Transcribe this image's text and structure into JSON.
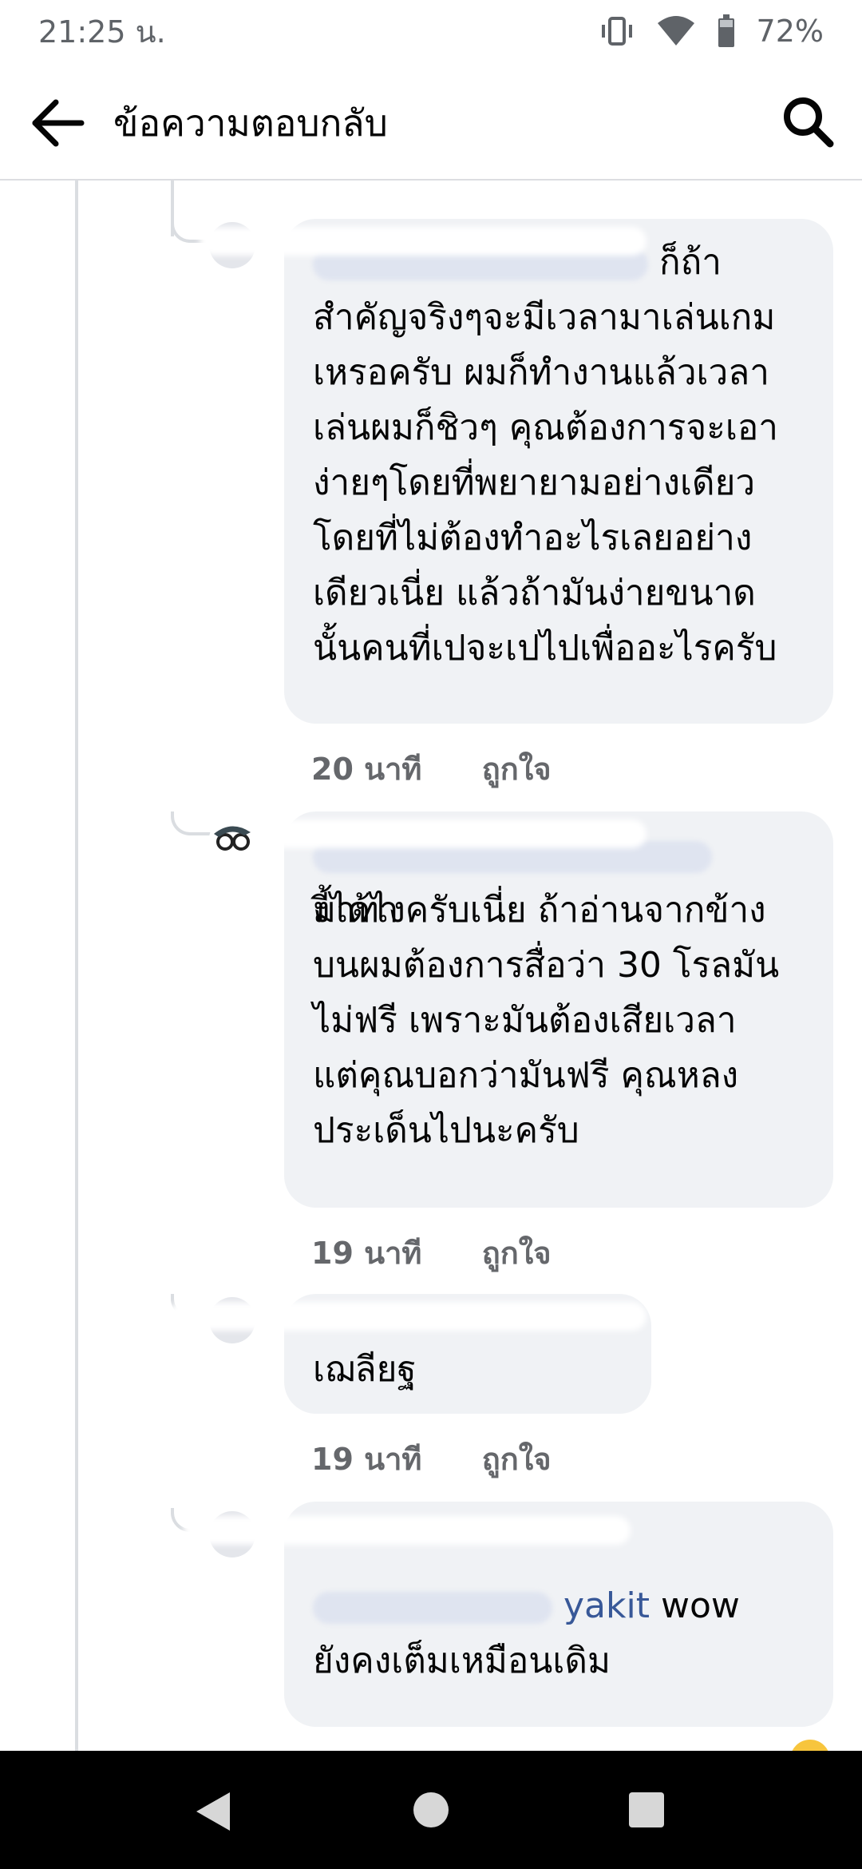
{
  "status_bar": {
    "time": "21:25 น.",
    "battery": "72%",
    "icons": [
      "vibrate-icon",
      "wifi-icon",
      "battery-icon"
    ]
  },
  "header": {
    "title": "ข้อความตอบกลับ",
    "back_icon": "arrow-left-icon",
    "search_icon": "search-icon"
  },
  "comments": [
    {
      "author": "",
      "mention_partial": "",
      "lines": [
        "ก็ถ้า",
        "สำคัญจริงๆจะมีเวลามาเล่นเกม",
        "เหรอครับ ผมก็ทำงานแล้วเวลา",
        "เล่นผมก็ชิวๆ คุณต้องการจะเอา",
        "ง่ายๆโดยที่พยายามอย่างเดียว",
        "โดยที่ไม่ต้องทำอะไรเลยอย่าง",
        "เดียวเนี่ย แล้วถ้ามันง่ายขนาด",
        "นั้นคนที่เปจะเปไปเพื่ออะไรครับ"
      ],
      "time": "20 นาที",
      "like_label": "ถูกใจ"
    },
    {
      "author": "",
      "lines": [
        "มาทา",
        "งี้ได้ไงครับเนี่ย ถ้าอ่านจากข้าง",
        "บนผมต้องการสื่อว่า 30 โรลมัน",
        "ไม่ฟรี เพราะมันต้องเสียเวลา",
        "แต่คุณบอกว่ามันฟรี คุณหลง",
        "ประเด็นไปนะครับ"
      ],
      "time": "19 นาที",
      "like_label": "ถูกใจ"
    },
    {
      "author": "",
      "lines": [
        "เฌลียฐ"
      ],
      "time": "19 นาที",
      "like_label": "ถูกใจ"
    },
    {
      "author": "",
      "mention_partial": "yakit",
      "lines": [
        "wow",
        "ยังคงเต็มเหมือนเดิม"
      ],
      "time": "",
      "like_label": ""
    }
  ],
  "nav": {
    "back": "triangle-back-icon",
    "home": "circle-home-icon",
    "recents": "square-recents-icon"
  },
  "colors": {
    "bubble": "#f0f2f5",
    "mention": "#385898",
    "meta": "#65676b",
    "thread_line": "#dadde1",
    "nav_bar": "#000000"
  }
}
